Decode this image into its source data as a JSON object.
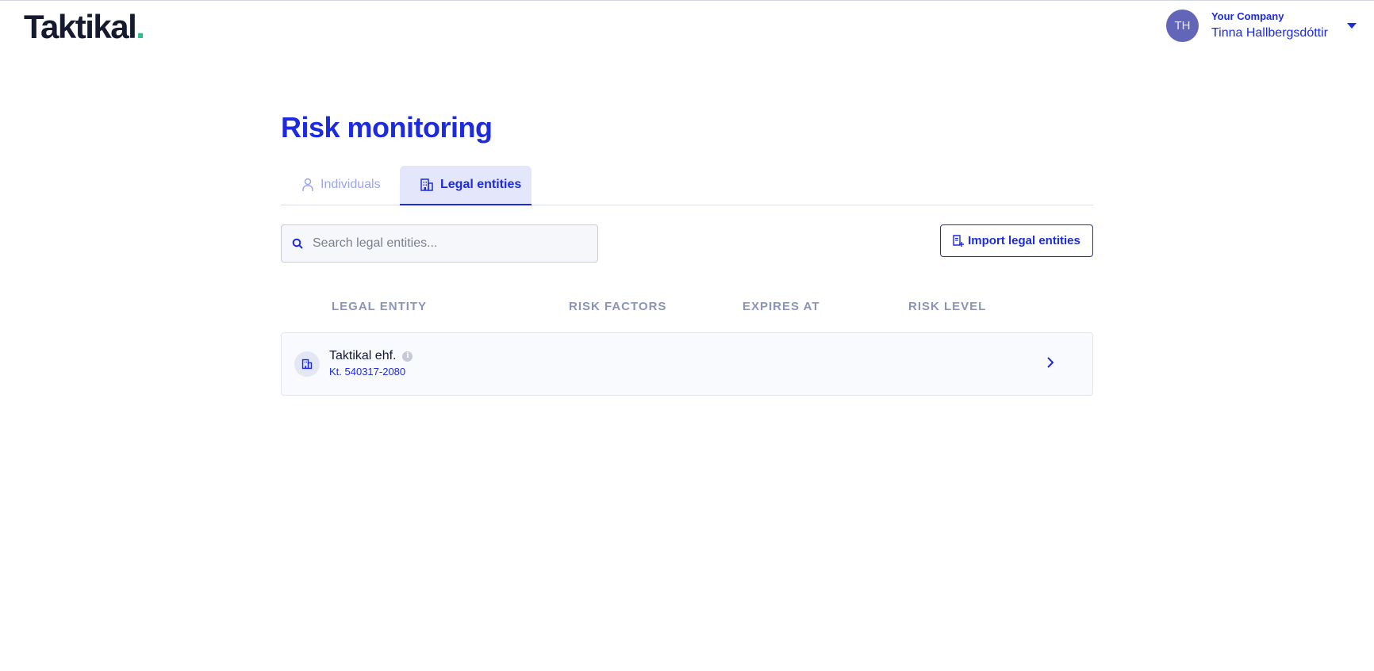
{
  "header": {
    "logo_text": "Taktikal",
    "logo_dot": ".",
    "avatar_initials": "TH",
    "company": "Your Company",
    "user_name": "Tinna Hallbergsdóttir"
  },
  "page": {
    "title": "Risk monitoring"
  },
  "tabs": [
    {
      "label": "Individuals",
      "icon": "person-icon",
      "active": false
    },
    {
      "label": "Legal entities",
      "icon": "building-icon",
      "active": true
    }
  ],
  "search": {
    "placeholder": "Search legal entities...",
    "value": ""
  },
  "toolbar": {
    "import_label": "Import legal entities"
  },
  "table": {
    "columns": [
      "LEGAL ENTITY",
      "RISK FACTORS",
      "EXPIRES AT",
      "RISK LEVEL"
    ],
    "rows": [
      {
        "name": "Taktikal ehf.",
        "id": "Kt. 540317-2080",
        "risk_factors": "",
        "expires_at": "",
        "risk_level": ""
      }
    ]
  },
  "colors": {
    "accent": "#1d2be0",
    "logo_dot": "#2dbf87",
    "avatar_bg": "#6366b8",
    "tab_active_bg": "#e4e7fb"
  }
}
